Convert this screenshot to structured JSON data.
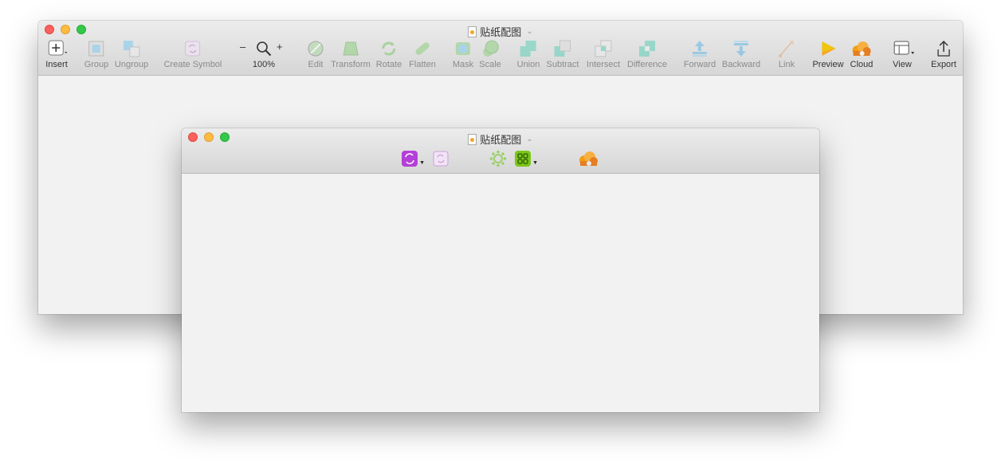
{
  "back_window": {
    "title": "贴纸配图",
    "toolbar": {
      "insert": "Insert",
      "group": "Group",
      "ungroup": "Ungroup",
      "create_symbol": "Create Symbol",
      "zoom_minus": "–",
      "zoom_plus": "+",
      "zoom": "100%",
      "edit": "Edit",
      "transform": "Transform",
      "rotate": "Rotate",
      "flatten": "Flatten",
      "mask": "Mask",
      "scale": "Scale",
      "union": "Union",
      "subtract": "Subtract",
      "intersect": "Intersect",
      "difference": "Difference",
      "forward": "Forward",
      "backward": "Backward",
      "link": "Link",
      "preview": "Preview",
      "cloud": "Cloud",
      "view": "View",
      "export": "Export"
    }
  },
  "front_window": {
    "title": "贴纸配图"
  },
  "colors": {
    "close": "#fc605c",
    "minimize": "#fdbc40",
    "maximize": "#34c84a",
    "teal": "#5fcfb9",
    "plugin_purple": "#b43fd8",
    "plugin_green": "#7bc618",
    "cloud_orange": "#f39c12",
    "preview_orange": "#f5a623"
  }
}
